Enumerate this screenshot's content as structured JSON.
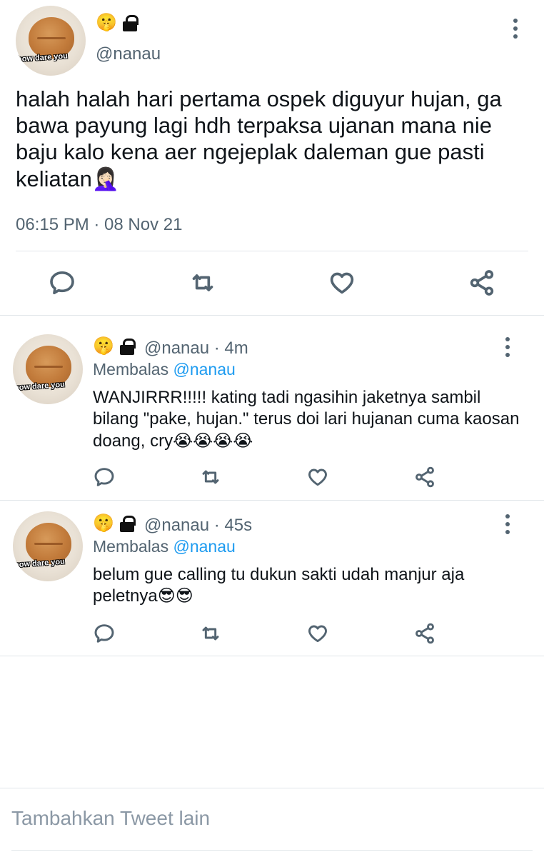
{
  "main_tweet": {
    "avatar_caption": "how dare you",
    "badge_emoji": "🤫",
    "badge_icon": "lock-icon",
    "handle": "@nanau",
    "text": "halah halah hari pertama ospek diguyur hujan, ga bawa payung lagi hdh terpaksa ujanan mana nie baju kalo kena aer ngejeplak daleman gue pasti keliatan🤦🏻‍♀️",
    "timestamp": "06:15 PM · 08 Nov 21",
    "actions": [
      "reply-icon",
      "retweet-icon",
      "like-icon",
      "share-icon"
    ]
  },
  "replies": [
    {
      "avatar_caption": "how dare you",
      "badge_emoji": "🤫",
      "handle_time": "@nanau · 4m",
      "replying_label": "Membalas",
      "replying_to": "@nanau",
      "text": "WANJIRRR!!!!! kating tadi ngasihin jaketnya sambil bilang \"pake, hujan.\" terus doi lari hujanan cuma kaosan doang, cry😭😭😭😭"
    },
    {
      "avatar_caption": "how dare you",
      "badge_emoji": "🤫",
      "handle_time": "@nanau · 45s",
      "replying_label": "Membalas",
      "replying_to": "@nanau",
      "text": "belum gue calling tu dukun sakti udah manjur aja peletnya😎😎"
    }
  ],
  "composer": {
    "placeholder": "Tambahkan Tweet lain"
  },
  "colors": {
    "text_primary": "#0f1419",
    "text_secondary": "#536471",
    "mention": "#1d9bf0",
    "divider": "#e1e6ea"
  }
}
